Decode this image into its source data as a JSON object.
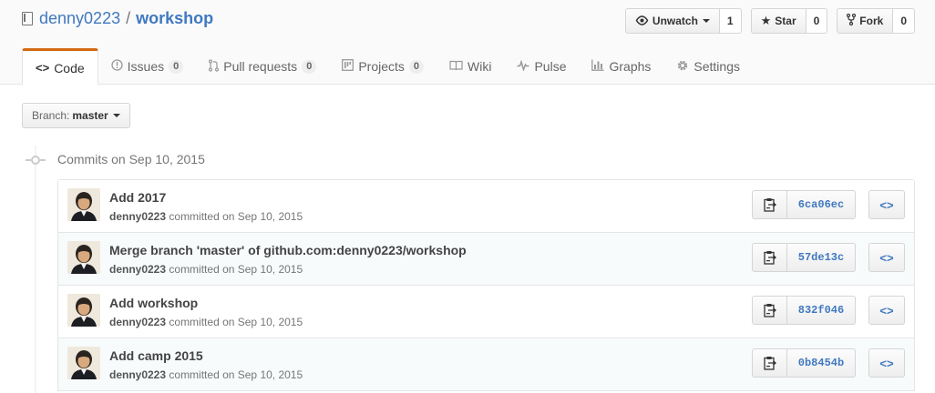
{
  "repo": {
    "owner": "denny0223",
    "separator": "/",
    "name": "workshop"
  },
  "actions": {
    "watch": {
      "label": "Unwatch",
      "count": "1"
    },
    "star": {
      "label": "Star",
      "count": "0"
    },
    "fork": {
      "label": "Fork",
      "count": "0"
    }
  },
  "tabs": [
    {
      "label": "Code",
      "icon": "code-icon",
      "selected": true
    },
    {
      "label": "Issues",
      "icon": "issue-icon",
      "count": "0"
    },
    {
      "label": "Pull requests",
      "icon": "pull-request-icon",
      "count": "0"
    },
    {
      "label": "Projects",
      "icon": "project-icon",
      "count": "0"
    },
    {
      "label": "Wiki",
      "icon": "book-icon"
    },
    {
      "label": "Pulse",
      "icon": "pulse-icon"
    },
    {
      "label": "Graphs",
      "icon": "graph-icon"
    },
    {
      "label": "Settings",
      "icon": "gear-icon"
    }
  ],
  "branch": {
    "label": "Branch:",
    "value": "master"
  },
  "commit_group": {
    "title": "Commits on Sep 10, 2015"
  },
  "commits": [
    {
      "message": "Add 2017",
      "author": "denny0223",
      "meta": "committed on Sep 10, 2015",
      "sha": "6ca06ec"
    },
    {
      "message": "Merge branch 'master' of github.com:denny0223/workshop",
      "author": "denny0223",
      "meta": "committed on Sep 10, 2015",
      "sha": "57de13c"
    },
    {
      "message": "Add workshop",
      "author": "denny0223",
      "meta": "committed on Sep 10, 2015",
      "sha": "832f046"
    },
    {
      "message": "Add camp 2015",
      "author": "denny0223",
      "meta": "committed on Sep 10, 2015",
      "sha": "0b8454b"
    }
  ],
  "colors": {
    "link": "#4078c0",
    "tab_accent": "#d26911"
  }
}
